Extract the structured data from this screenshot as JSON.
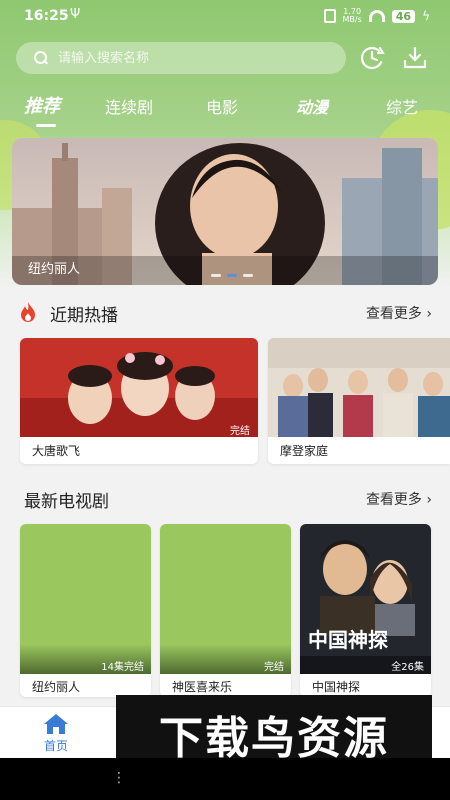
{
  "status_bar": {
    "time": "16:25",
    "usb_symbol": "Ψ",
    "net_speed_value": "1.70",
    "net_speed_unit": "MB/s",
    "battery": "46",
    "charging_symbol": "ϟ"
  },
  "search": {
    "placeholder": "请输入搜索名称"
  },
  "tabs": [
    {
      "label": "推荐",
      "active": true
    },
    {
      "label": "连续剧",
      "active": false
    },
    {
      "label": "电影",
      "active": false
    },
    {
      "label": "动漫",
      "active": false
    },
    {
      "label": "综艺",
      "active": false
    }
  ],
  "banner": {
    "caption": "纽约丽人",
    "dots": 3,
    "active_dot": 1
  },
  "hot_section": {
    "title": "近期热播",
    "more": "查看更多",
    "items": [
      {
        "title": "大唐歌飞",
        "badge": "完结"
      },
      {
        "title": "摩登家庭",
        "badge": ""
      }
    ]
  },
  "tv_section": {
    "title": "最新电视剧",
    "more": "查看更多",
    "items": [
      {
        "title": "纽约丽人",
        "badge": "14集完结",
        "poster_text": ""
      },
      {
        "title": "神医喜来乐",
        "badge": "完结",
        "poster_text": ""
      },
      {
        "title": "中国神探",
        "badge": "全26集",
        "poster_text": "中国神探"
      }
    ]
  },
  "bottom_nav": {
    "home_label": "首页"
  },
  "watermark": "下载鸟资源",
  "system_nav": {
    "menu_symbol": "⋮"
  },
  "colors": {
    "header_green": "#8fc870",
    "accent_blue": "#3a7bd5",
    "placeholder_green": "#9bc75f",
    "fire_red": "#e8432c"
  }
}
